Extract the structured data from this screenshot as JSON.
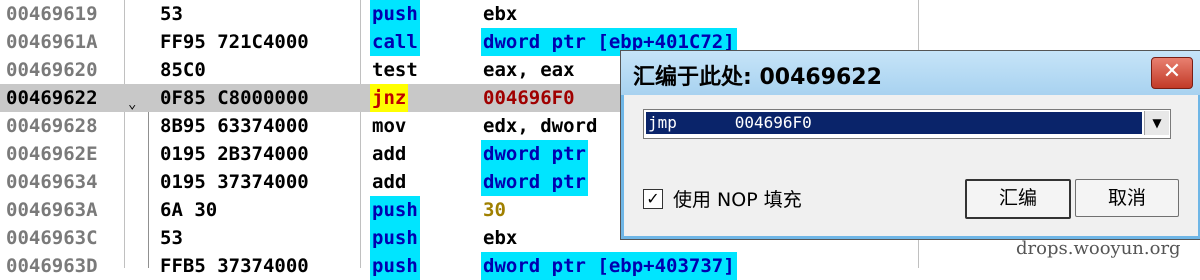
{
  "disasm": {
    "rows": [
      {
        "addr": "00469619",
        "hex": "53",
        "mn": "push",
        "op": "ebx"
      },
      {
        "addr": "0046961A",
        "hex": "FF95 721C4000",
        "mn": "call",
        "op": "dword ptr [ebp+401C72]"
      },
      {
        "addr": "00469620",
        "hex": "85C0",
        "mn": "test",
        "op": "eax, eax"
      },
      {
        "addr": "00469622",
        "hex": "0F85 C8000000",
        "mn": "jnz",
        "op": "004696F0"
      },
      {
        "addr": "00469628",
        "hex": "8B95 63374000",
        "mn": "mov",
        "op": "edx, dword"
      },
      {
        "addr": "0046962E",
        "hex": "0195 2B374000",
        "mn": "add",
        "op": "dword ptr"
      },
      {
        "addr": "00469634",
        "hex": "0195 37374000",
        "mn": "add",
        "op": "dword ptr"
      },
      {
        "addr": "0046963A",
        "hex": "6A 30",
        "mn": "push",
        "op": "30"
      },
      {
        "addr": "0046963C",
        "hex": "53",
        "mn": "push",
        "op": "ebx"
      },
      {
        "addr": "0046963D",
        "hex": "FFB5 37374000",
        "mn": "push",
        "op": "dword ptr [ebp+403737]"
      }
    ],
    "selected_addr": "00469622",
    "jump_arrow": "⌄"
  },
  "dialog": {
    "title": "汇编于此处: 00469622",
    "close_glyph": "✕",
    "combo_value": "jmp      004696F0",
    "combo_arrow": "▼",
    "nop_checked": "✓",
    "nop_label": "使用 NOP 填充",
    "assemble_label": "汇编",
    "cancel_label": "取消"
  },
  "watermark": "drops.wooyun.org"
}
